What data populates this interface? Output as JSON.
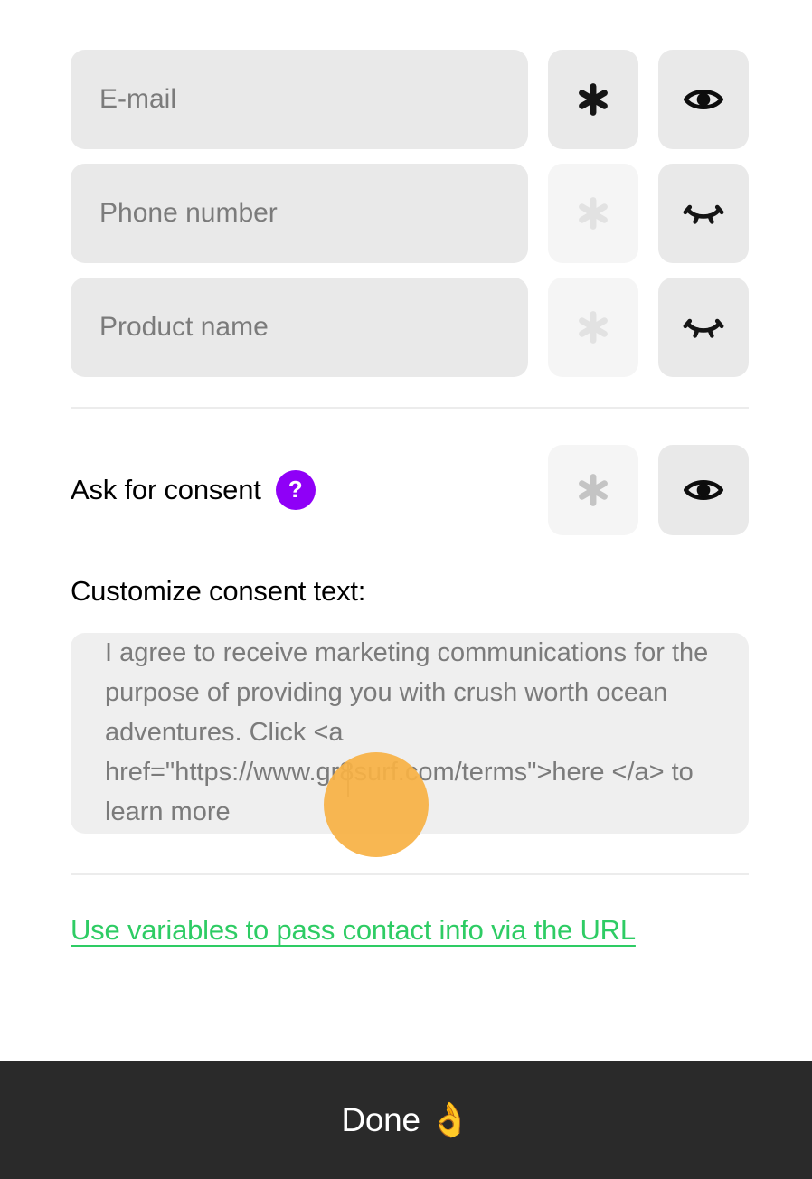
{
  "fields": [
    {
      "placeholder": "E-mail",
      "value": "",
      "required_state": "on",
      "visibility_state": "visible",
      "required_icon": "asterisk-icon",
      "visibility_icon": "eye-open-icon"
    },
    {
      "placeholder": "Phone number",
      "value": "",
      "required_state": "off",
      "visibility_state": "hidden",
      "required_icon": "asterisk-icon",
      "visibility_icon": "eye-closed-icon"
    },
    {
      "placeholder": "Product name",
      "value": "",
      "required_state": "off",
      "visibility_state": "hidden",
      "required_icon": "asterisk-icon",
      "visibility_icon": "eye-closed-icon"
    }
  ],
  "consent": {
    "label": "Ask for consent",
    "help_badge": "?",
    "help_icon": "question-mark-icon",
    "required_state": "off",
    "visibility_state": "visible",
    "required_icon": "asterisk-icon",
    "visibility_icon": "eye-open-icon"
  },
  "customize": {
    "title": "Customize consent text:",
    "textarea_value": "I agree to receive marketing communications for the purpose of providing you with crush worth ocean adventures. Click <a href=\"https://www.gr8surf.com/terms\">here </a> to learn more"
  },
  "link": {
    "label": "Use variables to pass contact info via the URL"
  },
  "footer": {
    "button_label": "Done 👌"
  },
  "colors": {
    "accent_green": "#2ecc64",
    "help_purple": "#8f00f7",
    "tap_orange": "#f7b143",
    "footer_dark": "#2a2a2a",
    "field_grey": "#e9e9e9",
    "field_grey_faded": "#f5f5f5"
  }
}
